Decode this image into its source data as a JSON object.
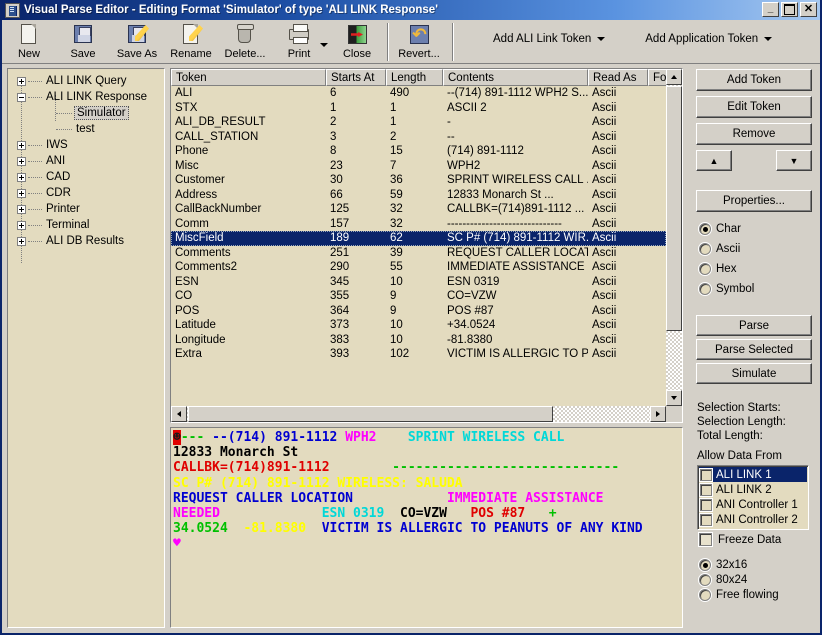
{
  "window": {
    "title": "Visual Parse Editor - Editing Format 'Simulator' of type 'ALI LINK Response'",
    "icon": "app-icon",
    "minimize_label": "_",
    "maximize_label": "",
    "close_label": "✕"
  },
  "toolbar": {
    "items": [
      {
        "label": "New",
        "icon": "new-page-icon"
      },
      {
        "label": "Save",
        "icon": "floppy-disk-icon"
      },
      {
        "label": "Save As",
        "icon": "floppy-disk-pencil-icon"
      },
      {
        "label": "Rename",
        "icon": "pencil-page-icon"
      },
      {
        "label": "Delete...",
        "icon": "trash-can-icon"
      },
      {
        "label": "Print",
        "icon": "printer-icon"
      },
      {
        "label": "Close",
        "icon": "close-door-icon"
      },
      {
        "label": "Revert...",
        "icon": "revert-arrow-icon"
      }
    ],
    "menus": [
      {
        "label": "Add ALI Link Token"
      },
      {
        "label": "Add Application Token"
      }
    ]
  },
  "tree": {
    "nodes": [
      {
        "label": "ALI LINK Query",
        "expander": "plus",
        "depth": 0,
        "selected": false
      },
      {
        "label": "ALI LINK Response",
        "expander": "minus",
        "depth": 0,
        "selected": false
      },
      {
        "label": "Simulator",
        "expander": "none",
        "depth": 1,
        "selected": true
      },
      {
        "label": "test",
        "expander": "none",
        "depth": 1,
        "selected": false
      },
      {
        "label": "IWS",
        "expander": "plus",
        "depth": 0,
        "selected": false
      },
      {
        "label": "ANI",
        "expander": "plus",
        "depth": 0,
        "selected": false
      },
      {
        "label": "CAD",
        "expander": "plus",
        "depth": 0,
        "selected": false
      },
      {
        "label": "CDR",
        "expander": "plus",
        "depth": 0,
        "selected": false
      },
      {
        "label": "Printer",
        "expander": "plus",
        "depth": 0,
        "selected": false
      },
      {
        "label": "Terminal",
        "expander": "plus",
        "depth": 0,
        "selected": false
      },
      {
        "label": "ALI DB Results",
        "expander": "plus",
        "depth": 0,
        "selected": false
      }
    ]
  },
  "token_list": {
    "columns": [
      {
        "label": "Token",
        "width": 155
      },
      {
        "label": "Starts At",
        "width": 60
      },
      {
        "label": "Length",
        "width": 57
      },
      {
        "label": "Contents",
        "width": 145
      },
      {
        "label": "Read As",
        "width": 60
      },
      {
        "label": "Form",
        "width": 32
      }
    ],
    "rows": [
      {
        "token": "ALI",
        "starts_at": "6",
        "length": "490",
        "contents": "--(714) 891-1112 WPH2   S...",
        "read_as": "Ascii",
        "form": "",
        "selected": false
      },
      {
        "token": "STX",
        "starts_at": "1",
        "length": "1",
        "contents": "ASCII 2",
        "read_as": "Ascii",
        "form": "",
        "selected": false
      },
      {
        "token": "ALI_DB_RESULT",
        "starts_at": "2",
        "length": "1",
        "contents": "-",
        "read_as": "Ascii",
        "form": "",
        "selected": false
      },
      {
        "token": "CALL_STATION",
        "starts_at": "3",
        "length": "2",
        "contents": "--",
        "read_as": "Ascii",
        "form": "",
        "selected": false
      },
      {
        "token": "Phone",
        "starts_at": "8",
        "length": "15",
        "contents": "(714) 891-1112",
        "read_as": "Ascii",
        "form": "",
        "selected": false
      },
      {
        "token": "Misc",
        "starts_at": "23",
        "length": "7",
        "contents": "WPH2",
        "read_as": "Ascii",
        "form": "",
        "selected": false
      },
      {
        "token": "Customer",
        "starts_at": "30",
        "length": "36",
        "contents": "SPRINT WIRELESS CALL  ...",
        "read_as": "Ascii",
        "form": "",
        "selected": false
      },
      {
        "token": "Address",
        "starts_at": "66",
        "length": "59",
        "contents": "12833 Monarch St         ...",
        "read_as": "Ascii",
        "form": "",
        "selected": false
      },
      {
        "token": "CallBackNumber",
        "starts_at": "125",
        "length": "32",
        "contents": "CALLBK=(714)891-1112     ...",
        "read_as": "Ascii",
        "form": "",
        "selected": false
      },
      {
        "token": "Comm",
        "starts_at": "157",
        "length": "32",
        "contents": "------------------------------",
        "read_as": "Ascii",
        "form": "",
        "selected": false
      },
      {
        "token": "MiscField",
        "starts_at": "189",
        "length": "62",
        "contents": "SC P# (714) 891-1112 WIR...",
        "read_as": "Ascii",
        "form": "",
        "selected": true
      },
      {
        "token": "Comments",
        "starts_at": "251",
        "length": "39",
        "contents": "REQUEST CALLER LOCAT...",
        "read_as": "Ascii",
        "form": "",
        "selected": false
      },
      {
        "token": "Comments2",
        "starts_at": "290",
        "length": "55",
        "contents": "IMMEDIATE ASSISTANCE ...",
        "read_as": "Ascii",
        "form": "",
        "selected": false
      },
      {
        "token": "ESN",
        "starts_at": "345",
        "length": "10",
        "contents": "ESN 0319",
        "read_as": "Ascii",
        "form": "",
        "selected": false
      },
      {
        "token": "CO",
        "starts_at": "355",
        "length": "9",
        "contents": "CO=VZW",
        "read_as": "Ascii",
        "form": "",
        "selected": false
      },
      {
        "token": "POS",
        "starts_at": "364",
        "length": "9",
        "contents": "POS #87",
        "read_as": "Ascii",
        "form": "",
        "selected": false
      },
      {
        "token": "Latitude",
        "starts_at": "373",
        "length": "10",
        "contents": "+34.0524",
        "read_as": "Ascii",
        "form": "",
        "selected": false
      },
      {
        "token": "Longitude",
        "starts_at": "383",
        "length": "10",
        "contents": "-81.8380",
        "read_as": "Ascii",
        "form": "",
        "selected": false
      },
      {
        "token": "Extra",
        "starts_at": "393",
        "length": "102",
        "contents": "VICTIM IS ALLERGIC TO P...",
        "read_as": "Ascii",
        "form": "",
        "selected": false
      }
    ]
  },
  "preview": {
    "colors": {
      "red": "#e00000",
      "green": "#00c000",
      "blue": "#0000d0",
      "magenta": "#ff00ff",
      "cyan": "#00d8d8",
      "yellow": "#ffff00",
      "black": "#000000",
      "background": "#e3dbbf"
    },
    "lines": [
      [
        {
          "t": "☻",
          "c": "red",
          "bg": "#e00000",
          "fg": "#1a1a1a"
        },
        {
          "t": "---",
          "c": "green"
        },
        {
          "t": " ",
          "c": "black"
        },
        {
          "t": "--(714) 891-1112",
          "c": "blue"
        },
        {
          "t": " ",
          "c": "black"
        },
        {
          "t": "WPH2",
          "c": "magenta"
        },
        {
          "t": "    ",
          "c": "black"
        },
        {
          "t": "SPRINT WIRELESS CALL",
          "c": "cyan"
        }
      ],
      [
        {
          "t": "12833 Monarch St",
          "c": "black"
        }
      ],
      [
        {
          "t": "CALLBK=(714)891-1112",
          "c": "red"
        },
        {
          "t": "        ",
          "c": "black"
        },
        {
          "t": "-----------------------------",
          "c": "green"
        }
      ],
      [
        {
          "t": "SC P# (714) 891-1112 WIRELESS: SALUDA",
          "c": "yellow"
        }
      ],
      [
        {
          "t": "REQUEST CALLER LOCATION",
          "c": "blue"
        },
        {
          "t": "            ",
          "c": "black"
        },
        {
          "t": "IMMEDIATE ASSISTANCE",
          "c": "magenta"
        }
      ],
      [
        {
          "t": "NEEDED",
          "c": "magenta"
        },
        {
          "t": "             ",
          "c": "black"
        },
        {
          "t": "ESN 0319",
          "c": "cyan"
        },
        {
          "t": "  ",
          "c": "black"
        },
        {
          "t": "CO=VZW",
          "c": "black"
        },
        {
          "t": "   ",
          "c": "black"
        },
        {
          "t": "POS #87",
          "c": "red"
        },
        {
          "t": "   ",
          "c": "black"
        },
        {
          "t": "+",
          "c": "green"
        }
      ],
      [
        {
          "t": "34.0524",
          "c": "green"
        },
        {
          "t": "  ",
          "c": "black"
        },
        {
          "t": "-81.8380",
          "c": "yellow"
        },
        {
          "t": "  ",
          "c": "black"
        },
        {
          "t": "VICTIM IS ALLERGIC TO PEANUTS OF ANY KIND",
          "c": "blue"
        }
      ],
      [
        {
          "t": "♥",
          "c": "magenta"
        }
      ]
    ]
  },
  "right_panel": {
    "buttons": [
      {
        "id": "add-token",
        "label": "Add Token",
        "accel": "A"
      },
      {
        "id": "edit-token",
        "label": "Edit Token",
        "accel": "E"
      },
      {
        "id": "remove",
        "label": "Remove",
        "accel": "R"
      },
      {
        "id": "properties",
        "label": "Properties...",
        "accel": "P"
      },
      {
        "id": "parse",
        "label": "Parse",
        "accel": "P"
      },
      {
        "id": "parse-selected",
        "label": "Parse Selected",
        "accel": "P"
      },
      {
        "id": "simulate",
        "label": "Simulate",
        "accel": ""
      }
    ],
    "move_up_label": "▲",
    "move_down_label": "▼",
    "display_modes": [
      {
        "label": "Char",
        "checked": true
      },
      {
        "label": "Ascii",
        "checked": false
      },
      {
        "label": "Hex",
        "checked": false
      },
      {
        "label": "Symbol",
        "checked": false
      }
    ],
    "selection_info": [
      {
        "label": "Selection Starts:",
        "value": ""
      },
      {
        "label": "Selection Length:",
        "value": ""
      },
      {
        "label": "Total Length:",
        "value": ""
      }
    ],
    "allow_data_from_label": "Allow Data From",
    "allow_data_from": [
      {
        "label": "ALI LINK 1",
        "checked": false,
        "selected": true
      },
      {
        "label": "ALI LINK 2",
        "checked": false,
        "selected": false
      },
      {
        "label": "ANI Controller 1",
        "checked": false,
        "selected": false
      },
      {
        "label": "ANI Controller 2",
        "checked": false,
        "selected": false
      }
    ],
    "freeze_data": {
      "label": "Freeze Data",
      "checked": false
    },
    "size_modes": [
      {
        "label": "32x16",
        "checked": true
      },
      {
        "label": "80x24",
        "checked": false
      },
      {
        "label": "Free flowing",
        "checked": false
      }
    ]
  }
}
